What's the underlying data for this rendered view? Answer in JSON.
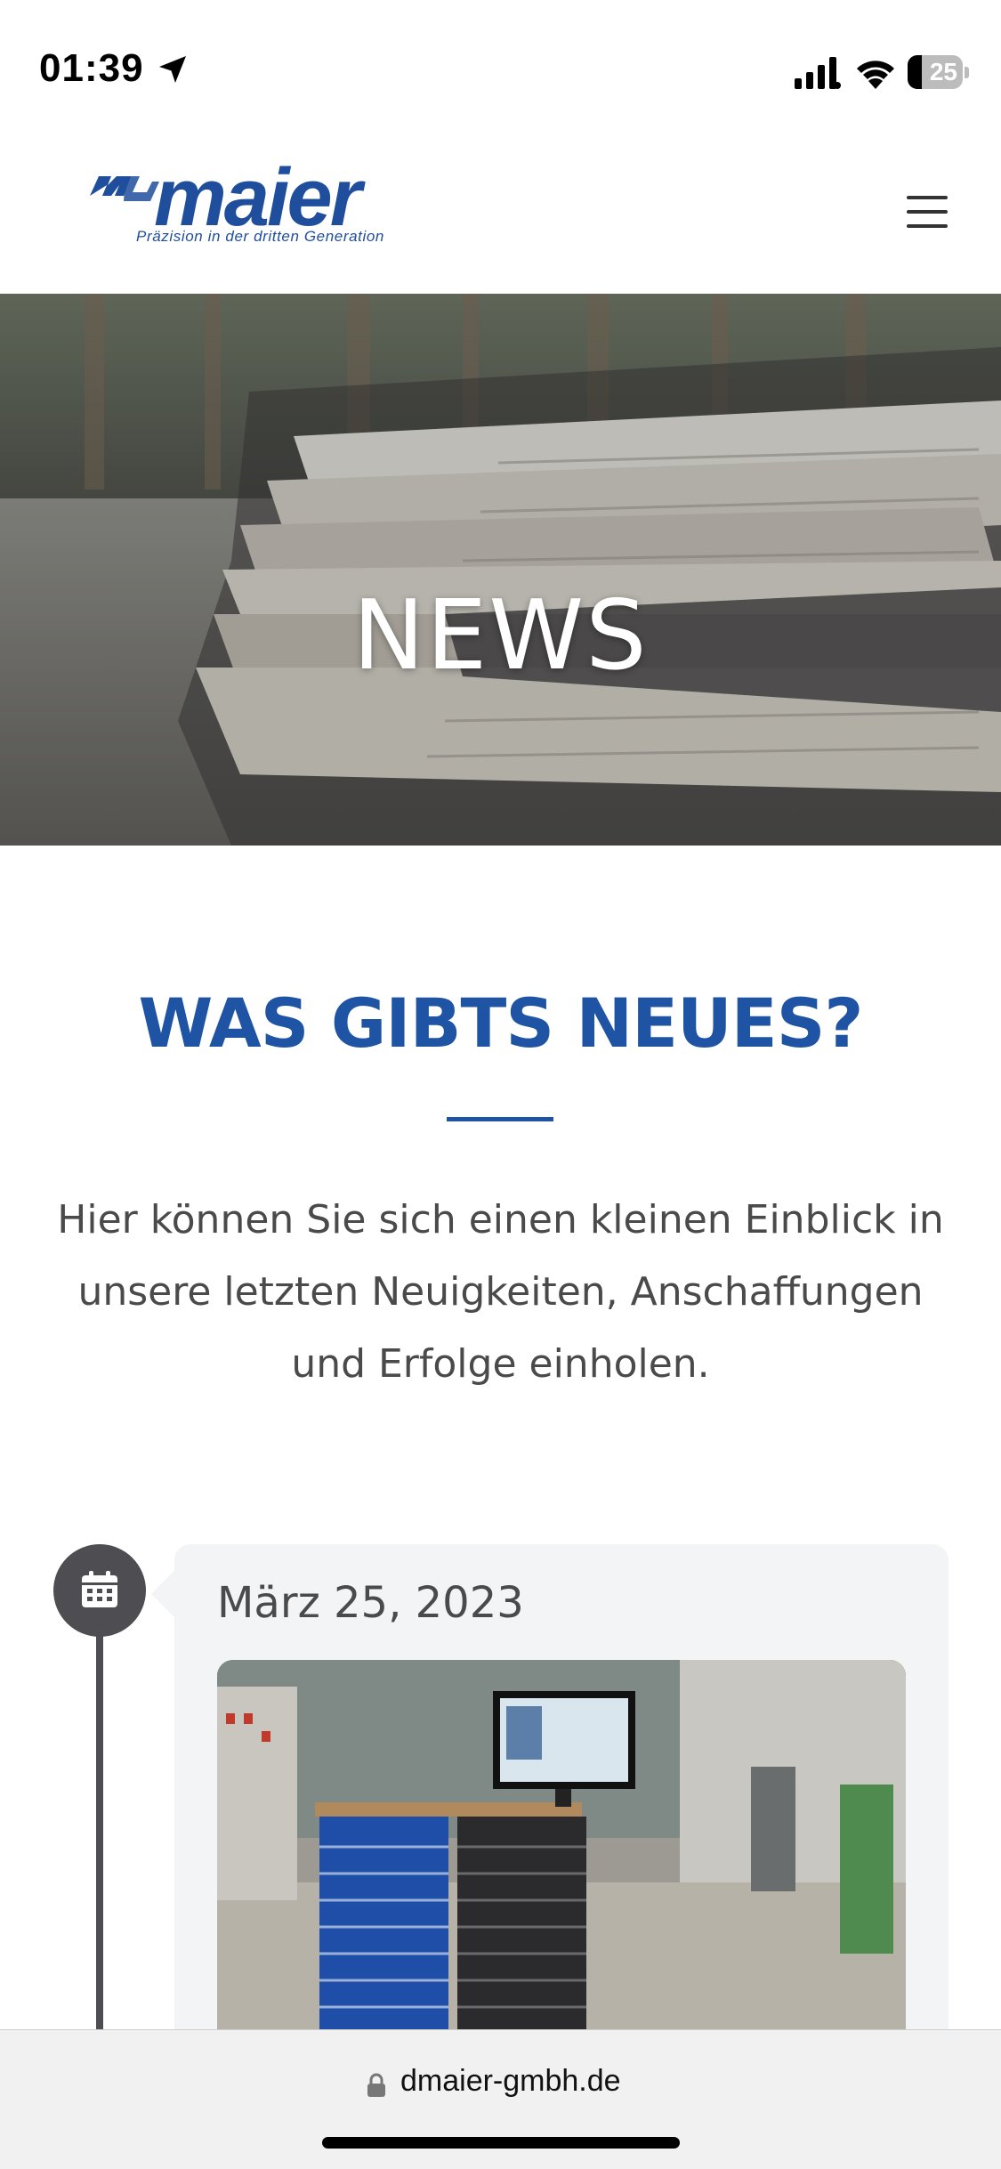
{
  "status_bar": {
    "time": "01:39",
    "battery_level": "25",
    "battery_fraction": 0.25,
    "icons": [
      "location-arrow-icon",
      "cellular-signal-icon",
      "wifi-icon",
      "battery-icon"
    ]
  },
  "header": {
    "logo_text": "maier",
    "logo_tagline": "Präzision in der dritten Generation",
    "brand_color": "#1f4e9c",
    "menu_icon": "hamburger-menu-icon"
  },
  "hero": {
    "title": "NEWS"
  },
  "intro": {
    "heading": "WAS GIBTS NEUES?",
    "text": "Hier können Sie sich einen kleinen Einblick in unsere letzten Neuigkeiten, Anschaffungen und Erfolge einholen.",
    "accent_color": "#1f54a4"
  },
  "timeline": {
    "items": [
      {
        "date": "März 25, 2023",
        "icon": "calendar-icon"
      }
    ]
  },
  "browser": {
    "url": "dmaier-gmbh.de",
    "lock_icon": "lock-icon"
  }
}
